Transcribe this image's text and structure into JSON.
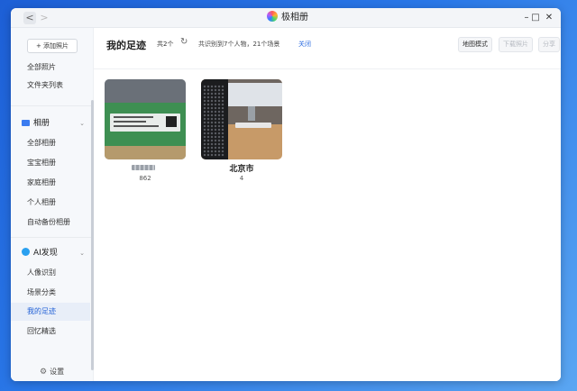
{
  "window": {
    "app_name": "极相册",
    "controls": {
      "minimize": "–",
      "maximize": "□",
      "close": "✕"
    },
    "nav": {
      "back": "<",
      "forward": ">"
    }
  },
  "sidebar": {
    "add_button": "+ 添加照片",
    "top_items": [
      {
        "label": "全部照片"
      },
      {
        "label": "文件夹列表"
      }
    ],
    "albums_section": {
      "label": "相册",
      "items": [
        {
          "label": "全部相册"
        },
        {
          "label": "宝宝相册"
        },
        {
          "label": "家庭相册"
        },
        {
          "label": "个人相册"
        },
        {
          "label": "自动备份相册"
        }
      ]
    },
    "ai_section": {
      "label": "AI发现",
      "items": [
        {
          "label": "人像识别"
        },
        {
          "label": "场景分类"
        },
        {
          "label": "我的足迹",
          "active": true
        },
        {
          "label": "回忆精选"
        }
      ]
    },
    "settings": "设置"
  },
  "main": {
    "title": "我的足迹",
    "count": "共2个",
    "summary": "共识别到7个人物，21个场景",
    "close_link": "关闭",
    "toolbar": {
      "map_mode": "地图模式",
      "download": "下载照片",
      "share": "分享"
    },
    "places": [
      {
        "name": "",
        "count": "862"
      },
      {
        "name": "北京市",
        "count": "4"
      }
    ]
  },
  "colors": {
    "accent": "#1f5fd6",
    "link": "#2f6ee0",
    "desktop": "#2a78e8"
  }
}
